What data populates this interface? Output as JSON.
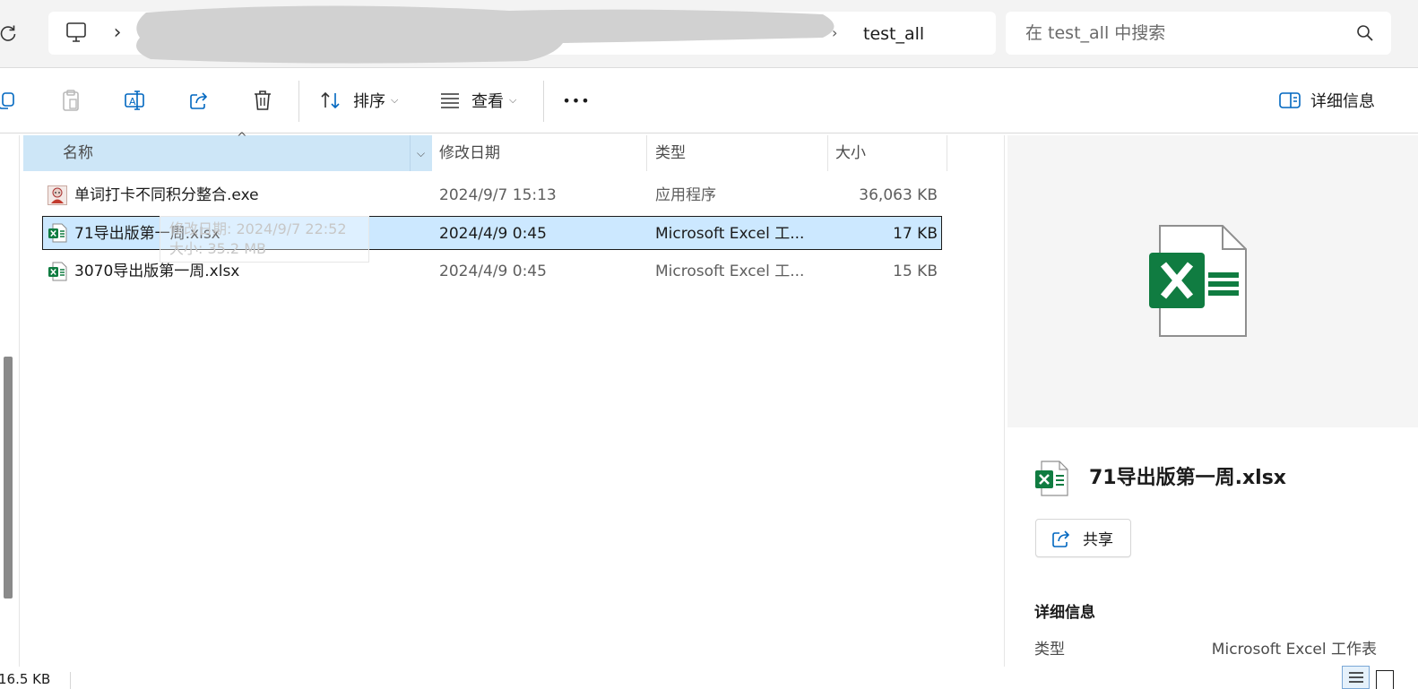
{
  "address": {
    "root_icon": "this-pc-icon",
    "separator": "›",
    "current_folder": "test_all"
  },
  "search": {
    "placeholder": "在 test_all 中搜索",
    "icon": "search-icon"
  },
  "toolbar": {
    "sort_label": "排序",
    "view_label": "查看",
    "more_label": "•••",
    "details_label": "详细信息"
  },
  "columns": {
    "name": "名称",
    "date": "修改日期",
    "type": "类型",
    "size": "大小"
  },
  "files": [
    {
      "name": "单词打卡不同积分整合.exe",
      "date": "2024/9/7 15:13",
      "type": "应用程序",
      "size": "36,063 KB",
      "icon": "app-icon",
      "selected": false
    },
    {
      "name": "71导出版第一周.xlsx",
      "date": "2024/4/9 0:45",
      "type": "Microsoft Excel 工...",
      "size": "17 KB",
      "icon": "excel-icon",
      "selected": true
    },
    {
      "name": "3070导出版第一周.xlsx",
      "date": "2024/4/9 0:45",
      "type": "Microsoft Excel 工...",
      "size": "15 KB",
      "icon": "excel-icon",
      "selected": false
    }
  ],
  "tooltip_ghost": {
    "line1": "修改日期: 2024/9/7 22:52",
    "line2": "大小: 35.2 MB"
  },
  "details_pane": {
    "title": "71导出版第一周.xlsx",
    "share_label": "共享",
    "section_heading": "详细信息",
    "prop_type_label": "类型",
    "prop_type_value": "Microsoft Excel 工作表"
  },
  "status": {
    "selected_size": "16.5 KB"
  },
  "colors": {
    "selection_bg": "#cce8ff",
    "header_sorted_bg": "#cde6f7",
    "excel_green": "#107c41",
    "accent_blue": "#0067c0"
  }
}
